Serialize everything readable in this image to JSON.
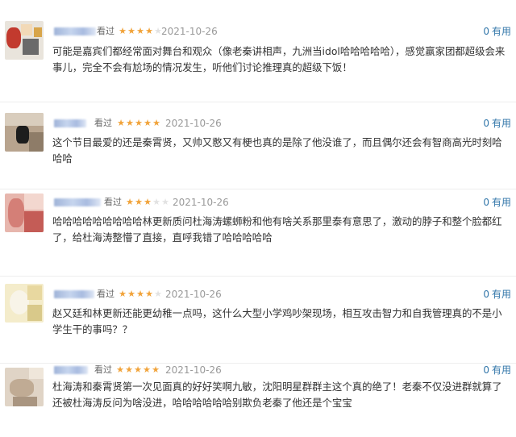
{
  "reviews": [
    {
      "status": "看过",
      "stars": 4,
      "date": "2021-10-26",
      "useful_count": "0",
      "useful_label": "有用",
      "text": "可能是嘉宾们都经常面对舞台和观众（像老秦讲相声，九洲当idol哈哈哈哈哈），感觉嬴家团都超级会来事儿，完全不会有尬场的情况发生，听他们讨论推理真的超级下饭！"
    },
    {
      "status": "看过",
      "stars": 5,
      "date": "2021-10-26",
      "useful_count": "0",
      "useful_label": "有用",
      "text": "这个节目最爱的还是秦霄贤，又帅又憨又有梗也真的是除了他没谁了，而且偶尔还会有智商高光时刻哈哈哈"
    },
    {
      "status": "看过",
      "stars": 3,
      "date": "2021-10-26",
      "useful_count": "0",
      "useful_label": "有用",
      "text": "哈哈哈哈哈哈哈哈哈林更新质问杜海涛螺蛳粉和他有啥关系那里泰有意思了，激动的脖子和整个脸都红了，给杜海涛整懵了直接，直呼我错了哈哈哈哈哈"
    },
    {
      "status": "看过",
      "stars": 4,
      "date": "2021-10-26",
      "useful_count": "0",
      "useful_label": "有用",
      "text": "赵又廷和林更新还能更幼稚一点吗，这什么大型小学鸡吵架现场，相互攻击智力和自我管理真的不是小学生干的事吗？？"
    },
    {
      "status": "看过",
      "stars": 5,
      "date": "2021-10-26",
      "useful_count": "0",
      "useful_label": "有用",
      "text": "杜海涛和秦霄贤第一次见面真的好好笑啊九敏，沈阳明星群群主这个真的绝了！老秦不仅没进群就算了还被杜海涛反问为啥没进，哈哈哈哈哈哈别欺负老秦了他还是个宝宝"
    }
  ]
}
